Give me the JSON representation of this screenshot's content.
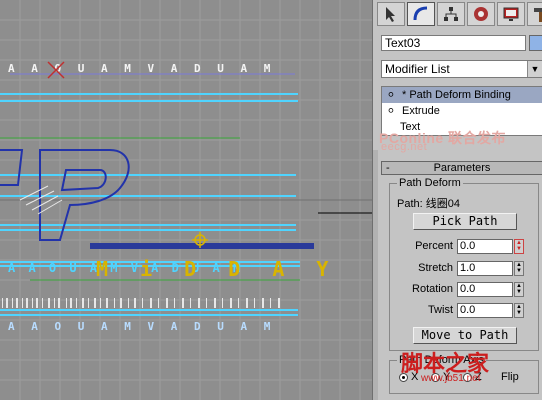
{
  "viewport": {
    "text_rows": [
      "A A O U A M   V A D U A M",
      "A A O U A M   V A D U A M",
      "A A O U A M   V A D U A M"
    ],
    "wave_text": "M i D D A Y",
    "colors": {
      "cyan": "#4fd4ff",
      "blue": "#2233aa",
      "purple": "#7b7bdb",
      "green": "#3aa83a",
      "gold": "#d8b400",
      "bg": "#8e8e8e"
    }
  },
  "panel": {
    "tabs": [
      "create-tab",
      "modify-tab",
      "hierarchy-tab",
      "motion-tab",
      "display-tab",
      "utilities-tab"
    ],
    "object_name": "Text03",
    "modifier_list": "Modifier List",
    "stack": [
      {
        "label": "* Path Deform Binding",
        "selected": true
      },
      {
        "label": "Extrude",
        "selected": false
      },
      {
        "label": "Text",
        "selected": false
      }
    ],
    "watermark_top": {
      "text": "PConline 联合发布",
      "url": "eecg.net"
    },
    "rollout_title": "Parameters",
    "group_title": "Path Deform",
    "path_label": "Path: 线圈04",
    "pick_path": "Pick Path",
    "spinners": [
      {
        "label": "Percent",
        "value": "0.0"
      },
      {
        "label": "Stretch",
        "value": "1.0"
      },
      {
        "label": "Rotation",
        "value": "0.0"
      },
      {
        "label": "Twist",
        "value": "0.0"
      }
    ],
    "move_to_path": "Move to Path",
    "group2_title": "Path Deform Axis",
    "axis": {
      "x": "X",
      "y": "Y",
      "z": "Z",
      "flip": "Flip"
    },
    "watermark_bottom": {
      "text": "脚本之家",
      "url": "www.jb51.net"
    }
  }
}
